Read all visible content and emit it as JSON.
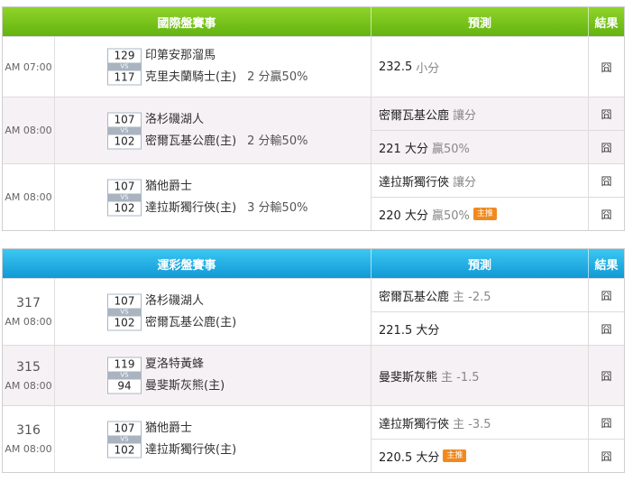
{
  "tables": [
    {
      "header": {
        "match": "國際盤賽事",
        "prediction": "預測",
        "result": "結果"
      },
      "rows": [
        {
          "num": "",
          "time": "AM 07:00",
          "away_score": "129",
          "home_score": "117",
          "vs": "VS",
          "away": "印第安那溜馬",
          "home": "克里夫蘭騎士(主)",
          "handicap": "2 分贏50%",
          "preds": [
            {
              "text": "232.5",
              "sub": "小分",
              "badge": ""
            }
          ],
          "results": [
            "囧"
          ]
        },
        {
          "num": "",
          "time": "AM 08:00",
          "away_score": "107",
          "home_score": "102",
          "vs": "VS",
          "away": "洛杉磯湖人",
          "home": "密爾瓦基公鹿(主)",
          "handicap": "2 分輸50%",
          "preds": [
            {
              "text": "密爾瓦基公鹿",
              "sub": "讓分",
              "badge": ""
            },
            {
              "text": "221 大分",
              "sub": "贏50%",
              "badge": ""
            }
          ],
          "results": [
            "囧",
            "囧"
          ]
        },
        {
          "num": "",
          "time": "AM 08:00",
          "away_score": "107",
          "home_score": "102",
          "vs": "VS",
          "away": "猶他爵士",
          "home": "達拉斯獨行俠(主)",
          "handicap": "3 分輸50%",
          "preds": [
            {
              "text": "達拉斯獨行俠",
              "sub": "讓分",
              "badge": ""
            },
            {
              "text": "220 大分",
              "sub": "贏50%",
              "badge": "主推"
            }
          ],
          "results": [
            "囧",
            "囧"
          ]
        }
      ]
    },
    {
      "header": {
        "match": "運彩盤賽事",
        "prediction": "預測",
        "result": "結果"
      },
      "rows": [
        {
          "num": "317",
          "time": "AM 08:00",
          "away_score": "107",
          "home_score": "102",
          "vs": "VS",
          "away": "洛杉磯湖人",
          "home": "密爾瓦基公鹿(主)",
          "handicap": "",
          "preds": [
            {
              "text": "密爾瓦基公鹿",
              "sub": "主 -2.5",
              "badge": ""
            },
            {
              "text": "221.5 大分",
              "sub": "",
              "badge": ""
            }
          ],
          "results": [
            "囧",
            "囧"
          ]
        },
        {
          "num": "315",
          "time": "AM 08:00",
          "away_score": "119",
          "home_score": "94",
          "vs": "VS",
          "away": "夏洛特黃蜂",
          "home": "曼斐斯灰熊(主)",
          "handicap": "",
          "preds": [
            {
              "text": "曼斐斯灰熊",
              "sub": "主 -1.5",
              "badge": ""
            }
          ],
          "results": [
            "囧"
          ]
        },
        {
          "num": "316",
          "time": "AM 08:00",
          "away_score": "107",
          "home_score": "102",
          "vs": "VS",
          "away": "猶他爵士",
          "home": "達拉斯獨行俠(主)",
          "handicap": "",
          "preds": [
            {
              "text": "達拉斯獨行俠",
              "sub": "主 -3.5",
              "badge": ""
            },
            {
              "text": "220.5 大分",
              "sub": "",
              "badge": "主推"
            }
          ],
          "results": [
            "囧",
            "囧"
          ]
        }
      ]
    }
  ]
}
